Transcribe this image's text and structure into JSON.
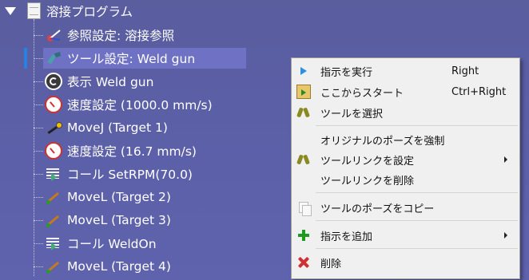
{
  "tree": {
    "root_label": "溶接プログラム",
    "items": [
      {
        "label": "参照設定: 溶接参照",
        "icon": "reference-frame-icon"
      },
      {
        "label": "ツール設定: Weld gun",
        "icon": "tool-icon",
        "selected": true
      },
      {
        "label": "表示 Weld gun",
        "icon": "show-sync-icon"
      },
      {
        "label": "速度設定 (1000.0 mm/s)",
        "icon": "speed-gauge-icon"
      },
      {
        "label": "MoveJ (Target 1)",
        "icon": "movej-icon"
      },
      {
        "label": "速度設定 (16.7 mm/s)",
        "icon": "speed-gauge-icon"
      },
      {
        "label": "コール SetRPM(70.0)",
        "icon": "program-call-icon"
      },
      {
        "label": "MoveL (Target 2)",
        "icon": "movel-icon"
      },
      {
        "label": "MoveL (Target 3)",
        "icon": "movel-icon"
      },
      {
        "label": "コール WeldOn",
        "icon": "program-call-icon"
      },
      {
        "label": "MoveL (Target 4)",
        "icon": "movel-icon"
      }
    ]
  },
  "context_menu": {
    "items": [
      {
        "label": "指示を実行",
        "shortcut": "Right",
        "icon": "play-icon"
      },
      {
        "label": "ここからスタート",
        "shortcut": "Ctrl+Right",
        "icon": "clipboard-play-icon"
      },
      {
        "label": "ツールを選択",
        "icon": "gripper-icon"
      },
      {
        "label": "オリジナルのポーズを強制"
      },
      {
        "label": "ツールリンクを設定",
        "icon": "gripper-icon",
        "submenu": true
      },
      {
        "label": "ツールリンクを削除"
      },
      {
        "label": "ツールのポーズをコピー",
        "icon": "copy-icon"
      },
      {
        "label": "指示を追加",
        "icon": "plus-icon",
        "submenu": true
      },
      {
        "label": "削除",
        "icon": "delete-x-icon"
      }
    ]
  },
  "colors": {
    "tree_background": "#5b5fa6",
    "selection": "#6f72c4",
    "menu_background": "#f0f0f0"
  }
}
